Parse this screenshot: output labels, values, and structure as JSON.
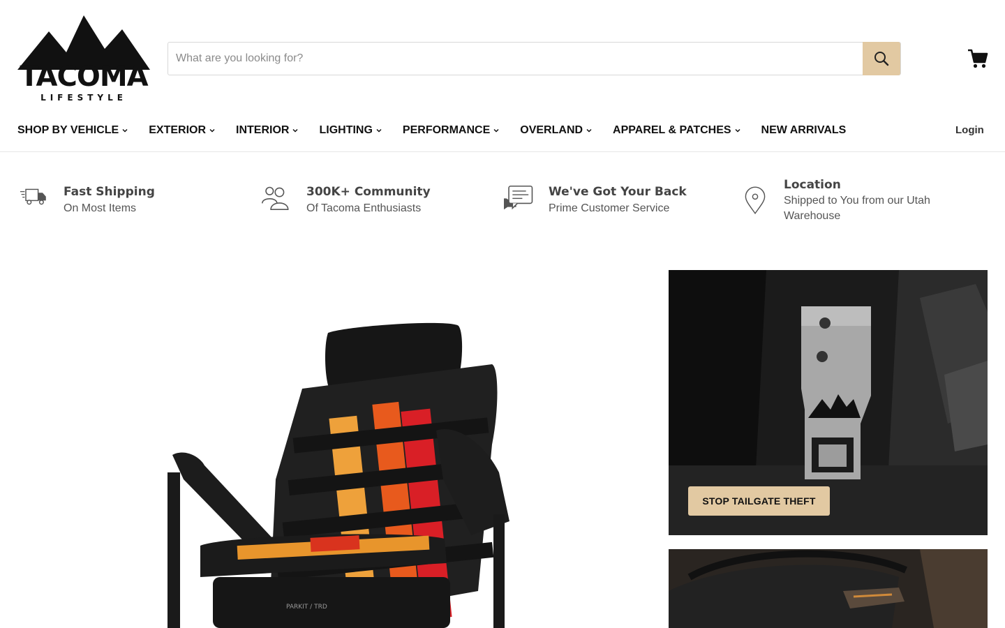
{
  "brand": {
    "logo_text": "TACOMA",
    "logo_sub": "LIFESTYLE"
  },
  "search": {
    "placeholder": "What are you looking for?",
    "value": ""
  },
  "nav": {
    "items": [
      {
        "label": "SHOP BY VEHICLE",
        "has_dropdown": true
      },
      {
        "label": "EXTERIOR",
        "has_dropdown": true
      },
      {
        "label": "INTERIOR",
        "has_dropdown": true
      },
      {
        "label": "LIGHTING",
        "has_dropdown": true
      },
      {
        "label": "PERFORMANCE",
        "has_dropdown": true
      },
      {
        "label": "OVERLAND",
        "has_dropdown": true
      },
      {
        "label": "APPAREL & PATCHES",
        "has_dropdown": true
      },
      {
        "label": "NEW ARRIVALS",
        "has_dropdown": false
      }
    ],
    "login": "Login"
  },
  "features": [
    {
      "icon": "truck-icon",
      "title": "Fast Shipping",
      "subtitle": "On Most Items"
    },
    {
      "icon": "community-icon",
      "title": "300K+ Community",
      "subtitle": "Of Tacoma Enthusiasts"
    },
    {
      "icon": "chat-icon",
      "title": "We've Got Your Back",
      "subtitle": "Prime Customer Service"
    },
    {
      "icon": "location-pin-icon",
      "title": "Location",
      "subtitle": "Shipped to You from our Utah Warehouse"
    }
  ],
  "hero": {
    "right_top_cta": "STOP TAILGATE THEFT"
  },
  "colors": {
    "accent": "#e2c9a2",
    "text": "#111111",
    "muted": "#555555"
  }
}
